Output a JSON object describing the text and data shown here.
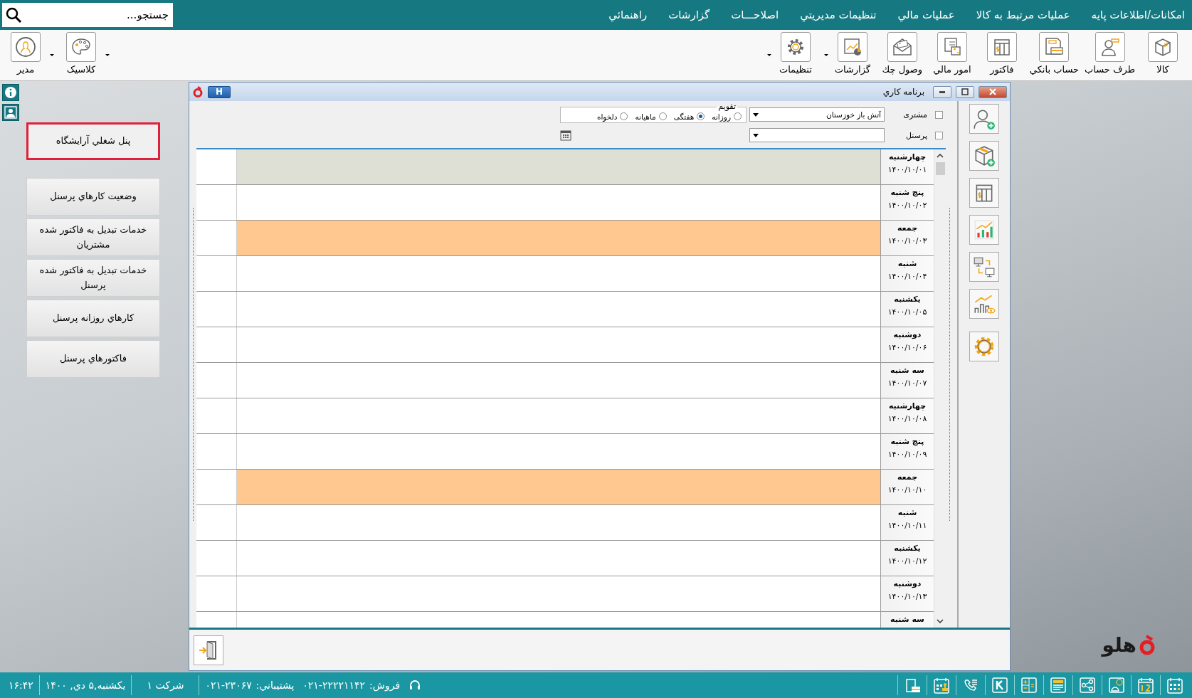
{
  "menu_bar": {
    "search": {
      "placeholder": "جستجو..."
    },
    "items": [
      "امکانات/اطلاعات پایه",
      "عملیات مرتبط به کالا",
      "عملیات مالي",
      "تنظیمات مدیریتي",
      "اصلاحـــات",
      "گزارشات",
      "راهنمائي"
    ]
  },
  "toolbar": {
    "items": [
      {
        "label": "کالا",
        "dropdown": false
      },
      {
        "label": "طرف حساب",
        "dropdown": false
      },
      {
        "label": "حساب بانکي",
        "dropdown": false
      },
      {
        "label": "فاکتور",
        "dropdown": false
      },
      {
        "label": "امور مالي",
        "dropdown": false
      },
      {
        "label": "وصول چك",
        "dropdown": false
      },
      {
        "label": "گزارشات",
        "dropdown": true
      },
      {
        "label": "تنظیمات",
        "dropdown": true
      }
    ],
    "user_items": [
      {
        "label": "کلاسیک",
        "dropdown": true
      },
      {
        "label": "مدیر",
        "dropdown": true
      }
    ]
  },
  "side_panel": {
    "items": [
      {
        "label": "پنل شغلي آرايشگاه",
        "selected": true
      },
      {
        "label": "وضعيت كارهاي پرسنل",
        "selected": false
      },
      {
        "label": "خدمات تبديل به فاكتور شده مشتريان",
        "selected": false
      },
      {
        "label": "خدمات تبديل به فاكتور شده پرسنل",
        "selected": false
      },
      {
        "label": "كارهاي روزانه پرسنل",
        "selected": false
      },
      {
        "label": "فاكتورهاي پرسنل",
        "selected": false
      }
    ]
  },
  "dialog": {
    "title": "برنامه کاري",
    "help_button": "H",
    "customer": {
      "label": "مشتری",
      "checked": false,
      "value": "آتش باز خوزستان"
    },
    "personnel": {
      "label": "پرسنل",
      "checked": false
    },
    "calendar": {
      "legend": "تقویم",
      "options": [
        {
          "label": "روزانه",
          "selected": false
        },
        {
          "label": "هفتگی",
          "selected": true
        },
        {
          "label": "ماهیانه",
          "selected": false
        },
        {
          "label": "دلخواه",
          "selected": false
        }
      ]
    },
    "rows": [
      {
        "day": "چهارشنبه",
        "date": "۱۴۰۰/۱۰/۰۱",
        "color": "#dfe0d5"
      },
      {
        "day": "پنج شنبه",
        "date": "۱۴۰۰/۱۰/۰۲",
        "color": "#ffffff"
      },
      {
        "day": "جمعه",
        "date": "۱۴۰۰/۱۰/۰۳",
        "color": "#ffc891"
      },
      {
        "day": "شنبه",
        "date": "۱۴۰۰/۱۰/۰۴",
        "color": "#ffffff"
      },
      {
        "day": "یکشنبه",
        "date": "۱۴۰۰/۱۰/۰۵",
        "color": "#ffffff"
      },
      {
        "day": "دوشنبه",
        "date": "۱۴۰۰/۱۰/۰۶",
        "color": "#ffffff"
      },
      {
        "day": "سه شنبه",
        "date": "۱۴۰۰/۱۰/۰۷",
        "color": "#ffffff"
      },
      {
        "day": "چهارشنبه",
        "date": "۱۴۰۰/۱۰/۰۸",
        "color": "#ffffff"
      },
      {
        "day": "پنج شنبه",
        "date": "۱۴۰۰/۱۰/۰۹",
        "color": "#ffffff"
      },
      {
        "day": "جمعه",
        "date": "۱۴۰۰/۱۰/۱۰",
        "color": "#ffc891"
      },
      {
        "day": "شنبه",
        "date": "۱۴۰۰/۱۰/۱۱",
        "color": "#ffffff"
      },
      {
        "day": "یکشنبه",
        "date": "۱۴۰۰/۱۰/۱۲",
        "color": "#ffffff"
      },
      {
        "day": "دوشنبه",
        "date": "۱۴۰۰/۱۰/۱۳",
        "color": "#ffffff"
      },
      {
        "day": "سه شنبه",
        "color": "#ffffff"
      }
    ]
  },
  "logo": {
    "text": "هلو"
  },
  "status_bar": {
    "sales": {
      "label": "فروش:",
      "number": "۰۲۱-۲۲۲۲۱۱۴۲"
    },
    "support": {
      "label": "پشتیباني:",
      "number": "۰۲۱-۲۳۰۶۷"
    },
    "company": "شرکت ۱",
    "date": "یکشنبه,۵ دي, ۱۴۰۰",
    "time": "۱۶:۴۲"
  }
}
